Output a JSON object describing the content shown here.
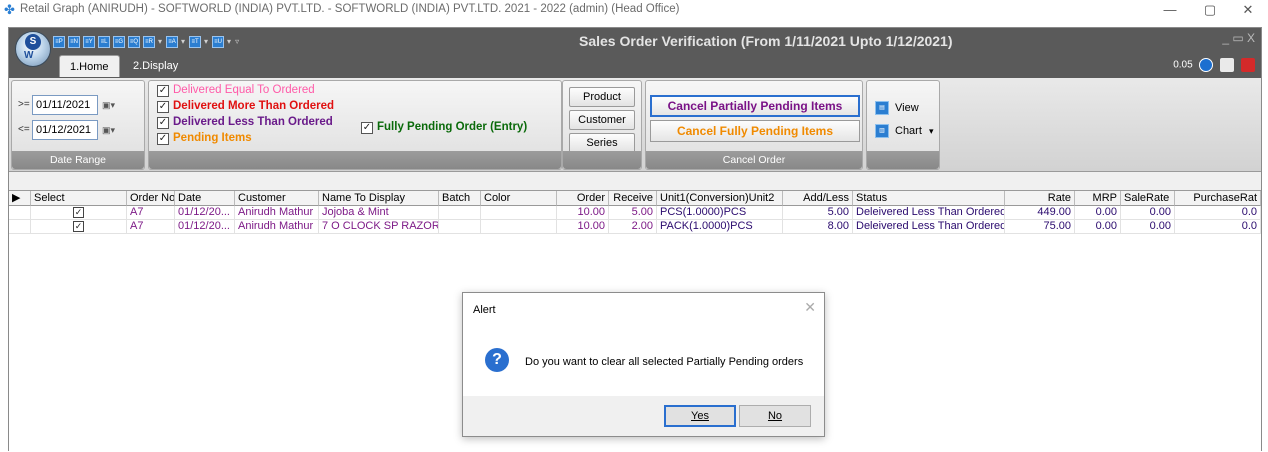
{
  "os_window": {
    "title": "Retail Graph (ANIRUDH) - SOFTWORLD (INDIA) PVT.LTD. - SOFTWORLD (INDIA) PVT.LTD.  2021 - 2022 (admin) (Head Office)",
    "minimize": "—",
    "maximize": "▢",
    "close": "✕"
  },
  "app": {
    "logo_letter": "S",
    "logo_text": "W",
    "title": "Sales Order Verification (From 1/11/2021 Upto 1/12/2021)",
    "window_controls": "_  ▭  X",
    "quick_access": [
      "≡P",
      "≡N",
      "≡Y",
      "≡L",
      "≡G",
      "≡Q",
      "≡R",
      "≡A",
      "≡T",
      "≡U"
    ],
    "tabs": [
      {
        "label": "1.Home",
        "active": true
      },
      {
        "label": "2.Display",
        "active": false
      }
    ],
    "version_value": "0.05"
  },
  "ribbon": {
    "date_range": {
      "from_op": ">=",
      "from_date": "01/11/2021",
      "to_op": "<=",
      "to_date": "01/12/2021",
      "label": "Date Range"
    },
    "filters": [
      {
        "label": "Delivered Equal To Ordered",
        "checked": true,
        "color": "#ff5aa8"
      },
      {
        "label": "Delivered More Than Ordered",
        "checked": true,
        "color": "#e01010"
      },
      {
        "label": "Delivered Less Than Ordered",
        "checked": true,
        "color": "#6a1b8a"
      },
      {
        "label": "Pending Items",
        "checked": true,
        "color": "#f08a00"
      }
    ],
    "fully_pending": {
      "label": "Fully Pending Order (Entry)",
      "checked": true,
      "color": "#0a6a0a"
    },
    "select_buttons": [
      "Product",
      "Customer",
      "Series"
    ],
    "cancel_order": {
      "partial": "Cancel Partially Pending Items",
      "full": "Cancel Fully Pending Items",
      "label": "Cancel Order",
      "partial_color": "#7a1287",
      "full_color": "#f08a00"
    },
    "view": {
      "view_label": "View",
      "chart_label": "Chart",
      "chart_dropdown": "▾"
    }
  },
  "grid": {
    "columns": [
      "",
      "Select",
      "Order No",
      "Date",
      "Customer",
      "Name To Display",
      "Batch",
      "Color",
      "Order",
      "Receive",
      "Unit1(Conversion)Unit2",
      "Add/Less",
      "Status",
      "Rate",
      "MRP",
      "SaleRate",
      "PurchaseRat"
    ],
    "rows": [
      {
        "selected": true,
        "order_no": "A7",
        "date": "01/12/20...",
        "customer": "Anirudh Mathur",
        "name": "Jojoba & Mint",
        "batch": "",
        "color": "",
        "order": "10.00",
        "receive": "5.00",
        "unit": "PCS(1.0000)PCS",
        "add_less": "5.00",
        "status": "Deleivered Less Than Ordered",
        "rate": "449.00",
        "mrp": "0.00",
        "sale_rate": "0.00",
        "purchase_rate": "0.0"
      },
      {
        "selected": true,
        "order_no": "A7",
        "date": "01/12/20...",
        "customer": "Anirudh Mathur",
        "name": "7 O CLOCK SP RAZOR",
        "batch": "",
        "color": "",
        "order": "10.00",
        "receive": "2.00",
        "unit": "PACK(1.0000)PCS",
        "add_less": "8.00",
        "status": "Deleivered Less Than Ordered",
        "rate": "75.00",
        "mrp": "0.00",
        "sale_rate": "0.00",
        "purchase_rate": "0.0"
      }
    ]
  },
  "alert": {
    "title": "Alert",
    "close": "✕",
    "icon": "?",
    "message": "Do you want to clear all selected Partially Pending orders",
    "yes": "Yes",
    "no": "No"
  }
}
